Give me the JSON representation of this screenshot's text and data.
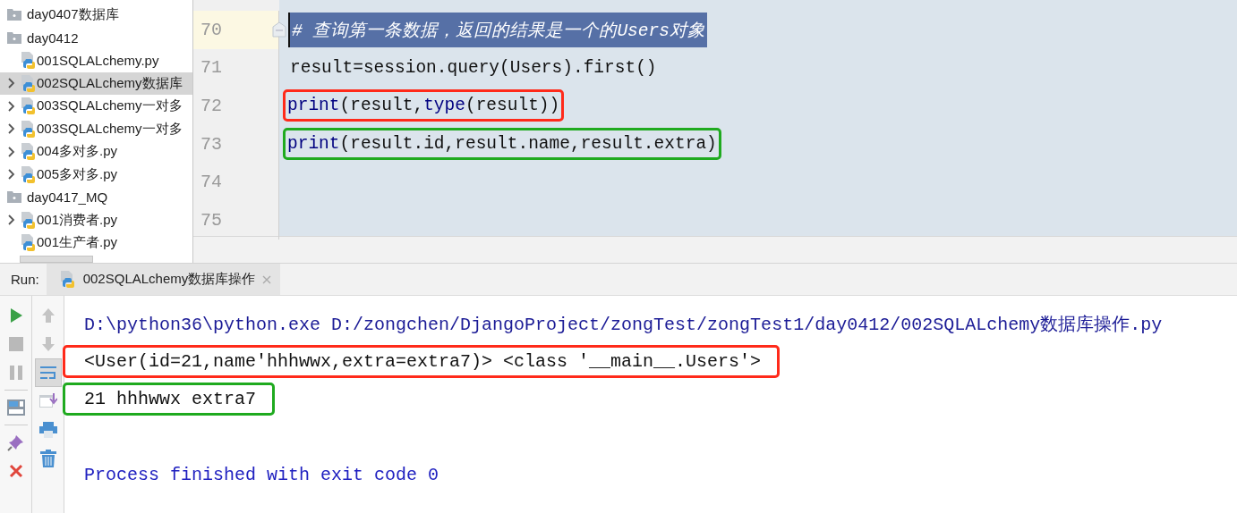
{
  "project_tree": [
    {
      "label": "day0407数据库",
      "kind": "folder",
      "selected": false
    },
    {
      "label": "day0412",
      "kind": "folder",
      "selected": false,
      "children": [
        {
          "label": "001SQLALchemy.py",
          "kind": "file",
          "expandable": false,
          "selected": false
        },
        {
          "label": "002SQLALchemy数据库",
          "kind": "file",
          "expandable": true,
          "selected": true
        },
        {
          "label": "003SQLALchemy一对多",
          "kind": "file",
          "expandable": true,
          "selected": false
        },
        {
          "label": "003SQLALchemy一对多",
          "kind": "file",
          "expandable": true,
          "selected": false
        },
        {
          "label": "004多对多.py",
          "kind": "file",
          "expandable": true,
          "selected": false
        },
        {
          "label": "005多对多.py",
          "kind": "file",
          "expandable": true,
          "selected": false
        }
      ]
    },
    {
      "label": "day0417_MQ",
      "kind": "folder",
      "selected": false,
      "children": [
        {
          "label": "001消费者.py",
          "kind": "file",
          "expandable": true,
          "selected": false
        },
        {
          "label": "001生产者.py",
          "kind": "file",
          "expandable": false,
          "selected": false
        }
      ]
    }
  ],
  "editor_lines": [
    {
      "number": "70",
      "kind": "comment",
      "selected": true,
      "segments": [
        {
          "text": "# 查询第一条数据，返回的结果是一个的Users对象",
          "kind": "comment"
        }
      ]
    },
    {
      "number": "71",
      "kind": "code",
      "selected": false,
      "segments": [
        {
          "text": "result=session.query(Users).first()",
          "kind": "plain"
        }
      ]
    },
    {
      "number": "72",
      "kind": "code",
      "selected": false,
      "color": "#ff2a1a",
      "segments": [
        {
          "text": "print",
          "kind": "builtin"
        },
        {
          "text": "(result,",
          "kind": "plain"
        },
        {
          "text": "type",
          "kind": "builtin"
        },
        {
          "text": "(result))",
          "kind": "plain"
        }
      ]
    },
    {
      "number": "73",
      "kind": "code",
      "selected": false,
      "color": "#1faa1f",
      "segments": [
        {
          "text": "print",
          "kind": "builtin"
        },
        {
          "text": "(result.id,result.name,result.extra)",
          "kind": "plain"
        }
      ]
    },
    {
      "number": "74",
      "kind": "code",
      "selected": false
    },
    {
      "number": "75",
      "kind": "code",
      "selected": false
    }
  ],
  "run_panel": {
    "label": "Run:",
    "tab": "002SQLALchemy数据库操作",
    "console_tools": [
      {
        "selected": false
      },
      {
        "selected": false
      },
      {
        "selected": true
      },
      {
        "selected": false
      },
      {
        "selected": false
      },
      {
        "selected": false
      }
    ],
    "console_lines": [
      {
        "kind": "command",
        "text": "D:\\python36\\python.exe D:/zongchen/DjangoProject/zongTest/zongTest1/day0412/002SQLALchemy数据库操作.py"
      },
      {
        "kind": "output",
        "color": "#ff2a1a",
        "text": "<User(id=21,name'hhhwwx,extra=extra7)> <class '__main__.Users'>"
      },
      {
        "kind": "output",
        "color": "#1faa1f",
        "text": "21 hhhwwx extra7"
      },
      {
        "kind": "blank"
      },
      {
        "kind": "exit",
        "text": "Process finished with exit code 0"
      }
    ]
  }
}
